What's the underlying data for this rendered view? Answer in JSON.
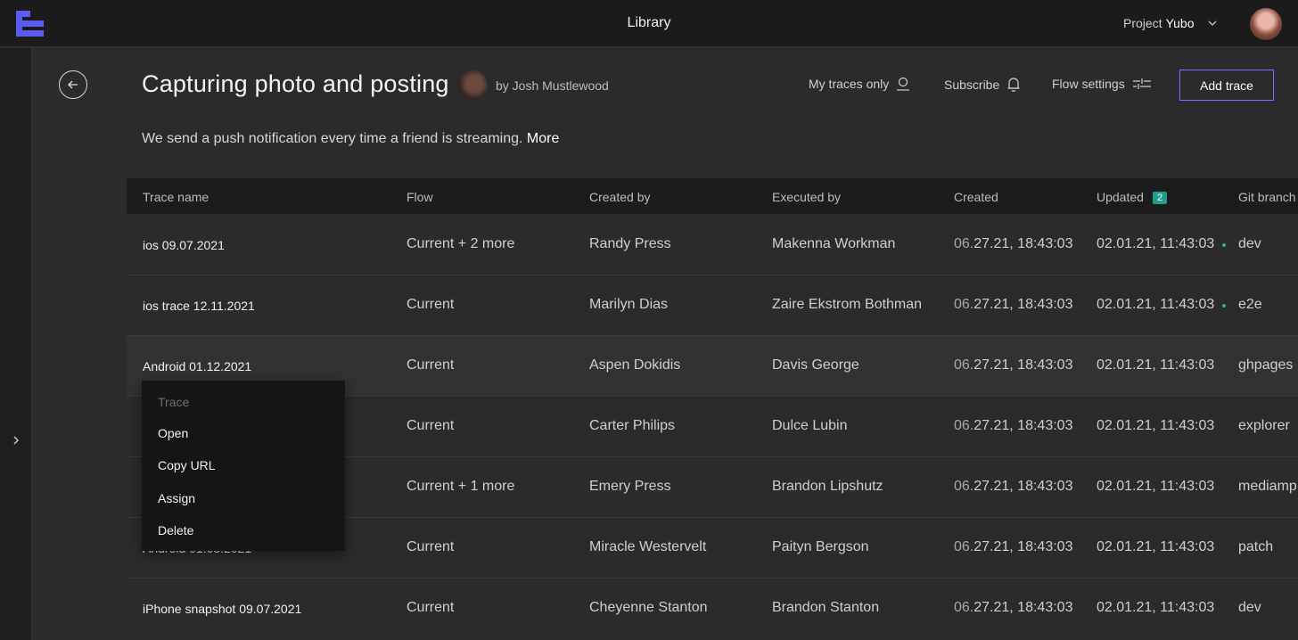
{
  "topbar": {
    "title": "Library",
    "project_label": "Project",
    "project_name": "Yubo"
  },
  "header": {
    "title": "Capturing photo and posting",
    "author": "by Josh Mustlewood",
    "actions": {
      "my_traces": "My traces only",
      "subscribe": "Subscribe",
      "flow_settings": "Flow settings",
      "add_trace": "Add trace"
    },
    "description": "We send a push notification every time a friend is streaming.",
    "more": "More"
  },
  "table": {
    "columns": [
      "Trace name",
      "Flow",
      "Created by",
      "Executed by",
      "Created",
      "Updated",
      "Git branch"
    ],
    "updated_badge": "2",
    "rows": [
      {
        "name": "ios 09.07.2021",
        "flow": "Current + 2 more",
        "created_by": "Randy Press",
        "executed_by": "Makenna Workman",
        "created_mo": "06.",
        "created_rest": "27.21, 18:43:03",
        "updated": "02.01.21, 11:43:03",
        "branch": "dev"
      },
      {
        "name": "ios trace 12.11.2021",
        "flow": "Current",
        "created_by": "Marilyn Dias",
        "executed_by": "Zaire Ekstrom Bothman",
        "created_mo": "06.",
        "created_rest": "27.21, 18:43:03",
        "updated": "02.01.21, 11:43:03",
        "branch": "e2e"
      },
      {
        "name": "Android 01.12.2021",
        "flow": "Current",
        "created_by": "Aspen Dokidis",
        "executed_by": "Davis George",
        "created_mo": "06.",
        "created_rest": "27.21, 18:43:03",
        "updated": "02.01.21, 11:43:03",
        "branch": "ghpages"
      },
      {
        "name": "",
        "flow": "Current",
        "created_by": "Carter Philips",
        "executed_by": "Dulce Lubin",
        "created_mo": "06.",
        "created_rest": "27.21, 18:43:03",
        "updated": "02.01.21, 11:43:03",
        "branch": "explorer"
      },
      {
        "name": "",
        "flow": "Current + 1 more",
        "created_by": "Emery Press",
        "executed_by": "Brandon Lipshutz",
        "created_mo": "06.",
        "created_rest": "27.21, 18:43:03",
        "updated": "02.01.21, 11:43:03",
        "branch": "mediamp"
      },
      {
        "name": "Android 01.05.2021",
        "flow": "Current",
        "created_by": "Miracle Westervelt",
        "executed_by": "Paityn Bergson",
        "created_mo": "06.",
        "created_rest": "27.21, 18:43:03",
        "updated": "02.01.21, 11:43:03",
        "branch": "patch"
      },
      {
        "name": "iPhone snapshot 09.07.2021",
        "flow": "Current",
        "created_by": "Cheyenne Stanton",
        "executed_by": "Brandon Stanton",
        "created_mo": "06.",
        "created_rest": "27.21, 18:43:03",
        "updated": "02.01.21, 11:43:03",
        "branch": "dev"
      }
    ]
  },
  "context_menu": {
    "title": "Trace",
    "items": [
      "Open",
      "Copy URL",
      "Assign",
      "Delete"
    ]
  },
  "colors": {
    "accent": "#6f72ff",
    "badge": "#1f9e8e",
    "logo": "#5b5cf6"
  }
}
